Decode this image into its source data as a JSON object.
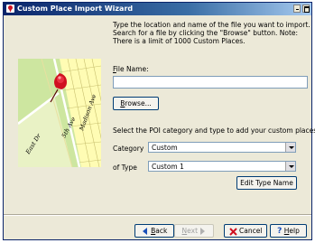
{
  "window": {
    "title": "Custom Place Import Wizard"
  },
  "description": {
    "line1": "Type the location and name of the file you want to import.",
    "line2": "Search for a file by clicking the \"Browse\" button. Note:",
    "line3": "There is a limit of 1000 Custom Places."
  },
  "file": {
    "label_prefix": "F",
    "label_rest": "ile Name:",
    "value": "",
    "browse_prefix": "B",
    "browse_rest": "rowse..."
  },
  "poi": {
    "instruction": "Select the POI category and type to add your custom places to:",
    "category_label": "Category",
    "category_value": "Custom",
    "type_label": "of Type",
    "type_value": "Custom 1",
    "edit_button": "Edit Type Name"
  },
  "map": {
    "streets": [
      "5th Ave",
      "Madison Ave",
      "East Dr"
    ]
  },
  "footer": {
    "back_prefix": "B",
    "back_rest": "ack",
    "next_prefix": "N",
    "next_rest": "ext",
    "cancel": "Cancel",
    "help_prefix": "H",
    "help_rest": "elp"
  },
  "colors": {
    "title_start": "#0a246a",
    "title_end": "#a6caf0",
    "dialog_bg": "#ece9d8",
    "map_park": "#cde6a0",
    "map_blocks": "#fffcb4",
    "pin": "#d01020"
  }
}
